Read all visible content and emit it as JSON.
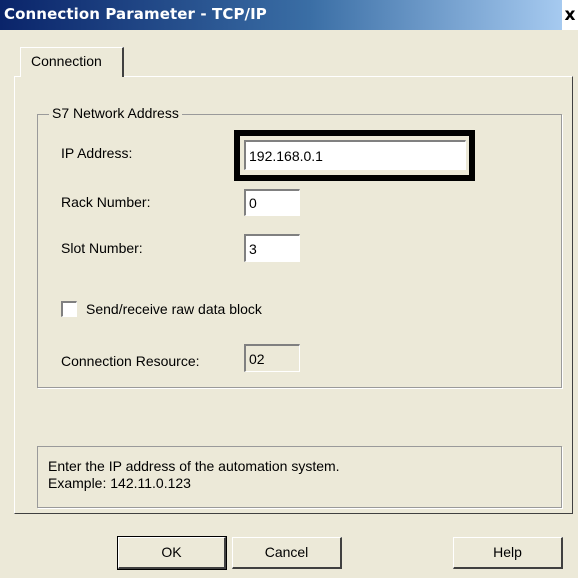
{
  "window": {
    "title": "Connection Parameter - TCP/IP",
    "close_label": "x"
  },
  "tabs": [
    {
      "label": "Connection",
      "active": true
    }
  ],
  "network_group": {
    "title": "S7 Network Address",
    "ip_address": {
      "label": "IP Address:",
      "value": "192.168.0.1"
    },
    "rack_number": {
      "label": "Rack Number:",
      "value": "0"
    },
    "slot_number": {
      "label": "Slot Number:",
      "value": "3"
    },
    "raw_data_block": {
      "label": "Send/receive raw data block",
      "checked": false
    },
    "connection_resource": {
      "label": "Connection Resource:",
      "value": "02"
    }
  },
  "info": {
    "line1": "Enter the IP address of the automation system.",
    "line2": "Example: 142.11.0.123"
  },
  "buttons": {
    "ok": "OK",
    "cancel": "Cancel",
    "help": "Help"
  },
  "colors": {
    "dialog_bg": "#ece9d8",
    "title_bar": "#0a246a",
    "highlight_border": "#000000"
  }
}
